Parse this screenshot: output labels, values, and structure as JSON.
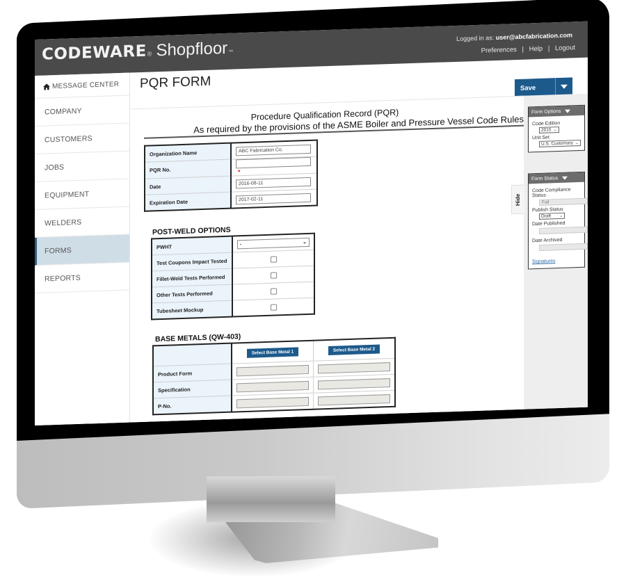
{
  "header": {
    "brand": "CODEWARE",
    "brand_mark": "®",
    "product": "Shopfloor",
    "product_mark": "™",
    "logged_in_label": "Logged in as:",
    "logged_in_user": "user@abcfabrication.com",
    "links": [
      "Preferences",
      "Help",
      "Logout"
    ],
    "link_separator": "|"
  },
  "sidebar": {
    "items": [
      {
        "label": "MESSAGE CENTER",
        "icon": "home-icon",
        "active": false
      },
      {
        "label": "COMPANY",
        "active": false
      },
      {
        "label": "CUSTOMERS",
        "active": false
      },
      {
        "label": "JOBS",
        "active": false
      },
      {
        "label": "EQUIPMENT",
        "active": false
      },
      {
        "label": "WELDERS",
        "active": false
      },
      {
        "label": "FORMS",
        "active": true
      },
      {
        "label": "REPORTS",
        "active": false
      }
    ]
  },
  "page": {
    "title": "PQR FORM",
    "save_label": "Save"
  },
  "form": {
    "title": "Procedure Qualification Record (PQR)",
    "subtitle": "As required by the provisions of the ASME Boiler and Pressure Vessel Code Rules",
    "header_fields": [
      {
        "label": "Organization Name",
        "value": "ABC Fabrication Co.",
        "required": false
      },
      {
        "label": "PQR No.",
        "value": "",
        "required": true,
        "required_mark": "*"
      },
      {
        "label": "Date",
        "value": "2016-08-11",
        "required": false
      },
      {
        "label": "Expiration Date",
        "value": "2017-02-11",
        "required": false
      }
    ],
    "post_weld": {
      "heading": "POST-WELD OPTIONS",
      "pwht_label": "PWHT",
      "pwht_value": "-",
      "checkboxes": [
        {
          "label": "Test Coupons Impact Tested",
          "checked": false
        },
        {
          "label": "Fillet-Weld Tests Performed",
          "checked": false
        },
        {
          "label": "Other Tests Performed",
          "checked": false
        },
        {
          "label": "Tubesheet Mockup",
          "checked": false
        }
      ]
    },
    "base_metals": {
      "heading": "BASE METALS (QW-403)",
      "buttons": [
        "Select Base Metal 1",
        "Select Base Metal 2"
      ],
      "rows": [
        "Product Form",
        "Specification",
        "P-No."
      ]
    }
  },
  "right_panel": {
    "hide_label": "Hide",
    "form_options": {
      "title": "Form Options",
      "code_edition_label": "Code Edition",
      "code_edition_value": "2015",
      "unit_set_label": "Unit Set",
      "unit_set_value": "U.S. Customary"
    },
    "form_status": {
      "title": "Form Status",
      "compliance_label": "Code Compliance Status",
      "compliance_value": "Fail",
      "publish_label": "Publish Status",
      "publish_value": "Draft",
      "date_published_label": "Date Published",
      "date_published_value": "",
      "date_archived_label": "Date Archived",
      "date_archived_value": "",
      "signatures_link": "Signatures"
    }
  },
  "colors": {
    "topbar": "#4a4a4a",
    "accent_blue": "#1d5a8c",
    "sidebar_active": "#cfdde6",
    "label_cell_bg": "#ebf4fb",
    "required": "#e2222a"
  }
}
